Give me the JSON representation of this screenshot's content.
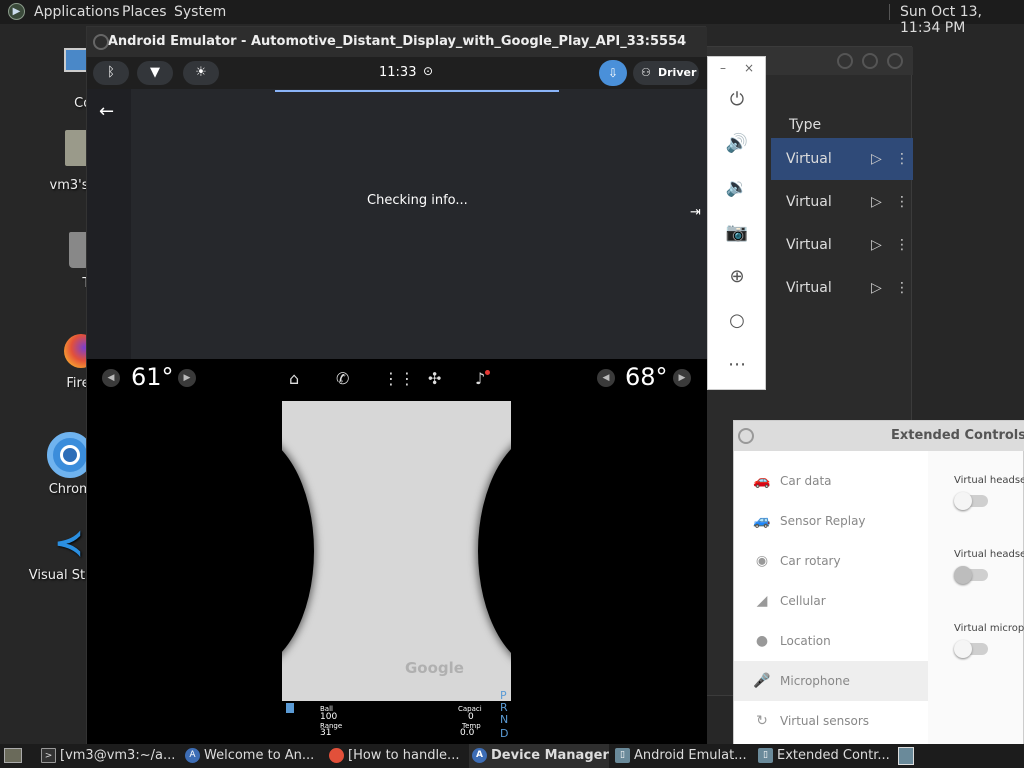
{
  "top_panel": {
    "applications": "Applications",
    "places": "Places",
    "system": "System",
    "clock": "Sun Oct 13, 11:34 PM"
  },
  "desktop": {
    "icons": [
      {
        "label": "Com"
      },
      {
        "label": "vm3's"
      },
      {
        "label": "Tr"
      },
      {
        "label": "Fire"
      },
      {
        "label": "Chromi"
      },
      {
        "label": "Visual Studi"
      }
    ]
  },
  "emulator": {
    "title": "Android Emulator - Automotive_Distant_Display_with_Google_Play_API_33:5554",
    "status_time": "11:33",
    "driver_label": "Driver",
    "checking": "Checking info...",
    "left_temp": "61°",
    "right_temp": "68°",
    "map_logo": "Google",
    "cluster": {
      "speed_label": "Ball",
      "speed_value": "100",
      "range_label": "Range",
      "range_value": "31",
      "cap_label": "Capaci",
      "cap_value": "0",
      "temp_label": "Temp",
      "temp_value": "0.0",
      "gears": [
        "P",
        "R",
        "N",
        "D"
      ]
    }
  },
  "device_manager": {
    "type_header": "Type",
    "rows": [
      "Virtual",
      "Virtual",
      "Virtual",
      "Virtual"
    ]
  },
  "extended_controls": {
    "title": "Extended Controls - A",
    "items": [
      "Car data",
      "Sensor Replay",
      "Car rotary",
      "Cellular",
      "Location",
      "Microphone",
      "Virtual sensors"
    ],
    "right_labels": [
      "Virtual headset",
      "Virtual headset",
      "Virtual micropho"
    ]
  },
  "taskbar": {
    "items": [
      "[vm3@vm3:~/a...",
      "Welcome to An...",
      "[How to handle...",
      "Device Manager",
      "Android Emulat...",
      "Extended Contr..."
    ]
  }
}
